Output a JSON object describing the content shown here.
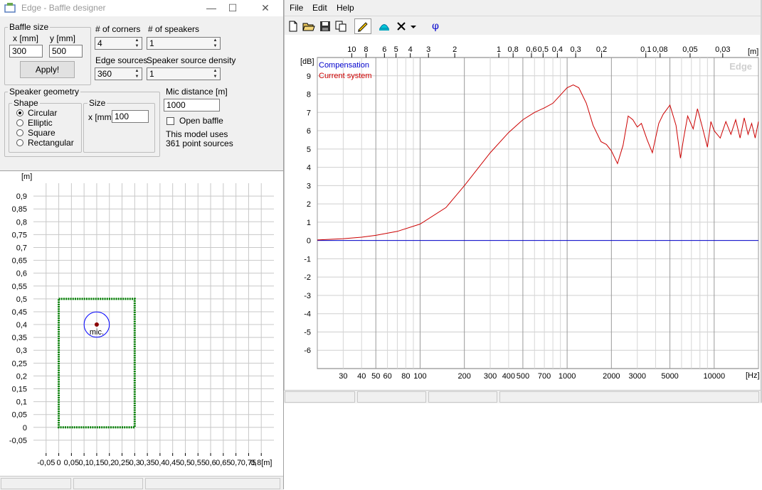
{
  "left_window": {
    "title": "Edge - Baffle designer",
    "controls": {
      "minimize": "—",
      "maximize": "☐",
      "close": "✕"
    },
    "baffle_size": {
      "label": "Baffle size",
      "x_label": "x [mm]",
      "y_label": "y [mm]",
      "x_value": "300",
      "y_value": "500",
      "apply_label": "Apply!"
    },
    "corners": {
      "label": "# of corners",
      "value": "4"
    },
    "speakers": {
      "label": "# of speakers",
      "value": "1"
    },
    "edge_sources": {
      "label": "Edge sources",
      "value": "360"
    },
    "speaker_density": {
      "label": "Speaker source density",
      "value": "1"
    },
    "speaker_geometry": {
      "label": "Speaker geometry",
      "shape_label": "Shape",
      "shapes": [
        "Circular",
        "Elliptic",
        "Square",
        "Rectangular"
      ],
      "selected_shape": "Circular",
      "size_label": "Size",
      "size_x_label": "x [mm]",
      "size_x_value": "100"
    },
    "mic_distance": {
      "label": "Mic distance [m]",
      "value": "1000"
    },
    "open_baffle": {
      "label": "Open baffle",
      "checked": false
    },
    "model_info": [
      "This model uses",
      "361 point sources"
    ],
    "baffle_plot": {
      "unit_label": "[m]",
      "y_ticks": [
        "0,9",
        "0,85",
        "0,8",
        "0,75",
        "0,7",
        "0,65",
        "0,6",
        "0,55",
        "0,5",
        "0,45",
        "0,4",
        "0,35",
        "0,3",
        "0,25",
        "0,2",
        "0,15",
        "0,1",
        "0,05",
        "0",
        "-0,05"
      ],
      "x_ticks": [
        "-0,05",
        "0",
        "0,05",
        "0,1",
        "0,15",
        "0,2",
        "0,25",
        "0,3",
        "0,35",
        "0,4",
        "0,45",
        "0,5",
        "0,55",
        "0,6",
        "0,65",
        "0,7",
        "0,75",
        "0,8"
      ],
      "x_unit": "[m]",
      "mic_label": "mic.",
      "baffle_color": "#008000",
      "speaker_color": "#0000ff",
      "mic_color": "#8b0000"
    }
  },
  "right_window": {
    "menu": [
      "File",
      "Edit",
      "Help"
    ],
    "toolbar_icons": [
      "new-file-icon",
      "open-folder-icon",
      "save-icon",
      "copy-icon",
      "pencil-icon",
      "speaker-icon",
      "clear-icon",
      "dropdown-arrow-icon",
      "phase-icon"
    ],
    "phase_symbol": "φ",
    "watermark": "Edge",
    "legend": [
      {
        "name": "Compensation",
        "color": "#0000cc"
      },
      {
        "name": "Current system",
        "color": "#cc0000"
      }
    ]
  },
  "chart_data": {
    "type": "line",
    "ylabel": "[dB]",
    "xlabel": "[Hz]",
    "top_axis_label": "[m]",
    "ylim": [
      -7,
      10
    ],
    "xlim": [
      20,
      20000
    ],
    "x_scale": "log",
    "grid": true,
    "legend_position": "top-left",
    "y_ticks": [
      "9",
      "8",
      "7",
      "6",
      "5",
      "4",
      "3",
      "2",
      "1",
      "0",
      "-1",
      "-2",
      "-3",
      "-4",
      "-5",
      "-6"
    ],
    "x_ticks": [
      30,
      40,
      50,
      60,
      80,
      100,
      200,
      300,
      400,
      500,
      700,
      1000,
      2000,
      3000,
      5000,
      10000
    ],
    "top_ticks": [
      {
        "label": "10",
        "hz": 34.3
      },
      {
        "label": "8",
        "hz": 42.9
      },
      {
        "label": "6",
        "hz": 57.2
      },
      {
        "label": "5",
        "hz": 68.6
      },
      {
        "label": "4",
        "hz": 85.8
      },
      {
        "label": "3",
        "hz": 114
      },
      {
        "label": "2",
        "hz": 172
      },
      {
        "label": "1",
        "hz": 343
      },
      {
        "label": "0,8",
        "hz": 429
      },
      {
        "label": "0,6",
        "hz": 572
      },
      {
        "label": "0,5",
        "hz": 686
      },
      {
        "label": "0,4",
        "hz": 858
      },
      {
        "label": "0,3",
        "hz": 1143
      },
      {
        "label": "0,2",
        "hz": 1715
      },
      {
        "label": "0,1",
        "hz": 3430
      },
      {
        "label": "0,08",
        "hz": 4288
      },
      {
        "label": "0,05",
        "hz": 6860
      },
      {
        "label": "0,03",
        "hz": 11433
      }
    ],
    "series": [
      {
        "name": "Compensation",
        "color": "#0000cc",
        "x": [
          20,
          20000
        ],
        "y": [
          0,
          0
        ]
      },
      {
        "name": "Current system",
        "color": "#cc0000",
        "x": [
          20,
          30,
          40,
          50,
          70,
          100,
          150,
          200,
          300,
          400,
          500,
          600,
          700,
          800,
          900,
          1000,
          1100,
          1200,
          1350,
          1500,
          1700,
          1850,
          2000,
          2200,
          2400,
          2600,
          2800,
          3000,
          3200,
          3500,
          3800,
          4200,
          4500,
          5000,
          5500,
          5900,
          6200,
          6600,
          7200,
          7700,
          8300,
          9000,
          9500,
          10000,
          11000,
          12000,
          13000,
          14000,
          15000,
          16000,
          17000,
          18000,
          19000,
          20000
        ],
        "y": [
          0.03,
          0.1,
          0.18,
          0.28,
          0.5,
          0.9,
          1.8,
          3.0,
          4.8,
          5.9,
          6.6,
          7.0,
          7.25,
          7.5,
          7.95,
          8.35,
          8.5,
          8.35,
          7.5,
          6.3,
          5.4,
          5.25,
          4.9,
          4.2,
          5.2,
          6.8,
          6.6,
          6.2,
          6.4,
          5.5,
          4.8,
          6.4,
          6.9,
          7.4,
          6.3,
          4.5,
          5.6,
          6.8,
          6.1,
          7.2,
          6.2,
          5.1,
          6.5,
          6.0,
          5.6,
          6.5,
          5.8,
          6.6,
          5.6,
          6.7,
          5.8,
          6.4,
          5.6,
          6.5
        ]
      }
    ]
  }
}
